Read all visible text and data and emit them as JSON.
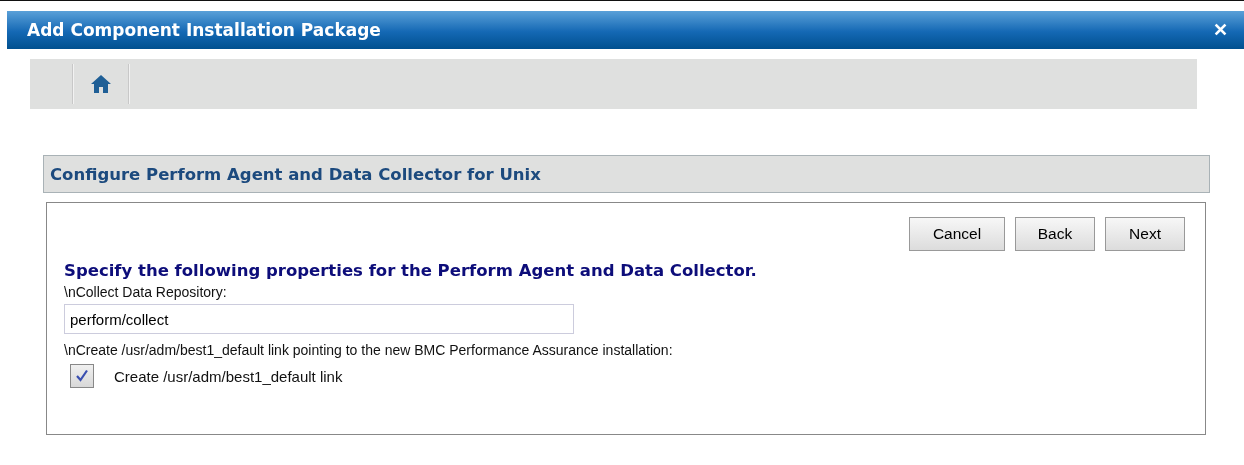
{
  "window": {
    "title": "Add Component Installation Package",
    "close": "✕"
  },
  "section": {
    "title": "Configure Perform Agent and Data Collector for Unix"
  },
  "buttons": [
    {
      "label": "Cancel"
    },
    {
      "label": "Back"
    },
    {
      "label": "Next"
    }
  ],
  "heading": "Specify the following properties for the Perform Agent and Data Collector.",
  "repository": {
    "label": "\\nCollect Data Repository:",
    "value": "perform/collect"
  },
  "link": {
    "label": "\\nCreate /usr/adm/best1_default link pointing to the new BMC Performance Assurance installation:",
    "checkbox": {
      "label": "Create /usr/adm/best1_default link",
      "checked": true
    }
  }
}
